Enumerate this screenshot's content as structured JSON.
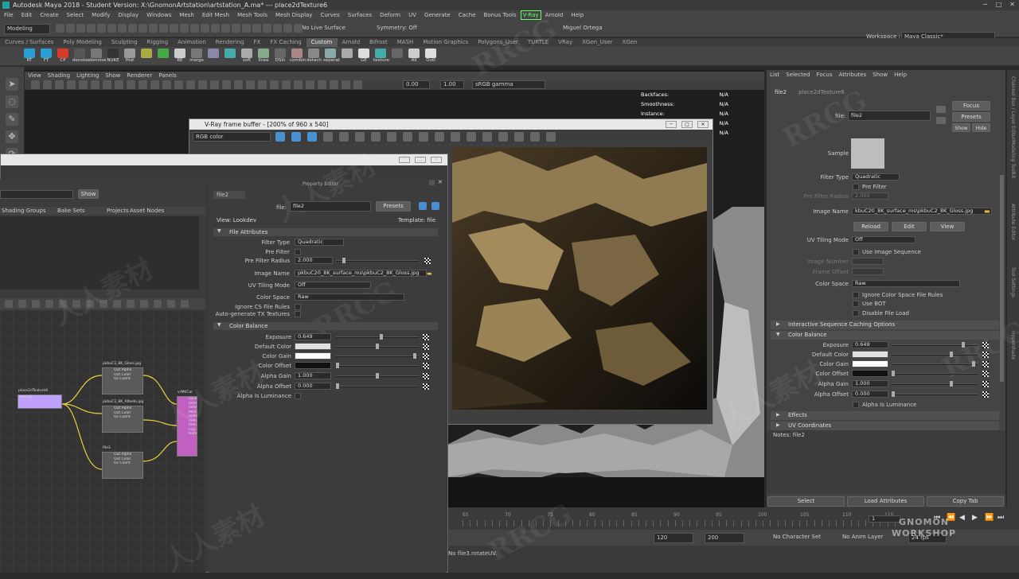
{
  "titlebar": {
    "title": "Autodesk Maya 2018 - Student Version: X:\\GnomonArtstation\\artstation_A.ma*   ---   place2dTexture6"
  },
  "menubar": [
    "File",
    "Edit",
    "Create",
    "Select",
    "Modify",
    "Display",
    "Windows",
    "Mesh",
    "Edit Mesh",
    "Mesh Tools",
    "Mesh Display",
    "Curves",
    "Surfaces",
    "Deform",
    "UV",
    "Generate",
    "Cache",
    "Bonus Tools",
    "V-Ray",
    "Arnold",
    "Help"
  ],
  "workspace": {
    "label": "Workspace :",
    "value": "Maya Classic*"
  },
  "status": {
    "mode": "Modeling",
    "live": "No Live Surface",
    "symmetry": "Symmetry: Off",
    "user": "Miguel Ortega"
  },
  "shelf_tabs": [
    "Curves / Surfaces",
    "Poly Modeling",
    "Sculpting",
    "Rigging",
    "Animation",
    "Rendering",
    "FX",
    "FX Caching",
    "Custom",
    "Arnold",
    "Bifrost",
    "MASH",
    "Motion Graphics",
    "Polygons_User",
    "TURTLE",
    "VRay",
    "XGen_User",
    "XGen"
  ],
  "shelf_active": "Custom",
  "shelf_buttons": [
    "RT",
    "FT",
    "CP",
    "denoise",
    "denoise",
    "NUKE",
    "Hist",
    "",
    "",
    "BE",
    "merge",
    "",
    "",
    "soft",
    "linee",
    "DSln",
    "combin",
    "detach",
    "seperat",
    "",
    "GE",
    "texture",
    "",
    "All",
    "Outl"
  ],
  "viewport": {
    "menu": [
      "View",
      "Shading",
      "Lighting",
      "Show",
      "Renderer",
      "Panels"
    ],
    "exposure": "0.00",
    "gamma": "1.00",
    "colorspace": "sRGB gamma",
    "hud": [
      {
        "k": "Backfaces:",
        "v": "N/A"
      },
      {
        "k": "Smoothness:",
        "v": "N/A"
      },
      {
        "k": "Instance:",
        "v": "N/A"
      },
      {
        "k": "",
        "v": "N/A"
      },
      {
        "k": "",
        "v": "N/A"
      }
    ]
  },
  "vfb": {
    "title": "V-Ray frame buffer - [200% of 960 x 540]",
    "channel": "RGB color"
  },
  "hypershade": {
    "show": "Show",
    "tabs": [
      "Shading Groups",
      "Bake Sets",
      "Projects",
      "Asset Nodes"
    ],
    "nodes": [
      {
        "title": "place2dTexture6",
        "ports": [
          "Out UV"
        ]
      },
      {
        "title": "pkbuC2_8K_Gloss.jpg",
        "ports": [
          "Out Alpha",
          "Out Color",
          "Uv Coord"
        ]
      },
      {
        "title": "pkbuC2_8K_Albedo.jpg",
        "ports": [
          "Out Alpha",
          "Out Color",
          "Uv Coord"
        ]
      },
      {
        "title": "file3",
        "ports": [
          "Out Alpha",
          "Out Color",
          "Uv Coord"
        ]
      },
      {
        "title": "vrMtlCar",
        "ports": [
          "Opacity M",
          "Reflection",
          "Reflection",
          "Metalness",
          "Reflection",
          "Reflection",
          "Refraction",
          "Fog Color",
          "Bump Map"
        ]
      }
    ]
  },
  "property_editor": {
    "title": "Property Editor",
    "tab": "file2",
    "file_label": "file:",
    "file_value": "file2",
    "presets": "Presets",
    "view": "View: Lookdev",
    "template": "Template: file",
    "sections": [
      "File Attributes",
      "Color Balance"
    ],
    "file_attrs": [
      {
        "label": "Filter Type",
        "value": "Quadratic"
      },
      {
        "label": "Pre Filter",
        "value": ""
      },
      {
        "label": "Pre Filter Radius",
        "value": "2.000"
      },
      {
        "label": "UV Tiling Mode",
        "value": "Off"
      },
      {
        "label": "Image Name",
        "value": "pkbuC20_8K_surface_ms\\pkbuC2_8K_Gloss.jpg"
      },
      {
        "label": "Color Space",
        "value": "Raw"
      },
      {
        "label": "Ignore CS File Rules",
        "value": ""
      },
      {
        "label": "Auto-generate TX Textures",
        "value": ""
      }
    ],
    "color_balance": [
      {
        "label": "Exposure",
        "value": "0.649",
        "pos": 0.55
      },
      {
        "label": "Default Color",
        "value": "",
        "pos": 0.5
      },
      {
        "label": "Color Gain",
        "value": "",
        "pos": 0.97
      },
      {
        "label": "Color Offset",
        "value": "",
        "pos": 0.0
      },
      {
        "label": "Alpha Gain",
        "value": "1.000",
        "pos": 0.5
      },
      {
        "label": "Alpha Offset",
        "value": "0.000",
        "pos": 0.0
      }
    ],
    "alpha_lum": "Alpha Is Luminance"
  },
  "attr_editor": {
    "menu": [
      "List",
      "Selected",
      "Focus",
      "Attributes",
      "Show",
      "Help"
    ],
    "tabs": [
      "file2",
      "place2dTexture6"
    ],
    "file_label": "file:",
    "file_value": "file2",
    "focus": "Focus",
    "presets": "Presets",
    "show": "Show",
    "hide": "Hide",
    "sample": "Sample",
    "rows": [
      {
        "label": "Filter Type",
        "value": "Quadratic"
      },
      {
        "label": "Pre Filter Radius",
        "value": "2.000"
      },
      {
        "label": "Image Name",
        "value": "kbuC20_8K_surface_ms\\pkbuC2_8K_Gloss.jpg"
      },
      {
        "label": "UV Tiling Mode",
        "value": "Off"
      },
      {
        "label": "Image Number",
        "value": ""
      },
      {
        "label": "Frame Offset",
        "value": ""
      },
      {
        "label": "Color Space",
        "value": "Raw"
      }
    ],
    "checks": [
      "Pre Filter",
      "Use Image Sequence",
      "Ignore Color Space File Rules",
      "Use BOT",
      "Disable File Load",
      "Alpha Is Luminance"
    ],
    "buttons": [
      "Reload",
      "Edit",
      "View"
    ],
    "sections": [
      "Interactive Sequence Caching Options",
      "Color Balance",
      "Effects",
      "UV Coordinates"
    ],
    "balance": [
      {
        "label": "Exposure",
        "value": "0.649",
        "pos": 0.85
      },
      {
        "label": "Default Color",
        "value": "",
        "pos": 0.7
      },
      {
        "label": "Color Gain",
        "value": "",
        "pos": 0.97
      },
      {
        "label": "Color Offset",
        "value": "",
        "pos": 0.0
      },
      {
        "label": "Alpha Gain",
        "value": "1.000",
        "pos": 0.7
      },
      {
        "label": "Alpha Offset",
        "value": "0.000",
        "pos": 0.0
      }
    ],
    "notes": "Notes:  file2",
    "bottom": [
      "Select",
      "Load Attributes",
      "Copy Tab"
    ]
  },
  "timeline": {
    "ticks": [
      "65",
      "70",
      "75",
      "80",
      "85",
      "90",
      "95",
      "100",
      "105",
      "110",
      "115"
    ],
    "frame": "1",
    "start": "120",
    "end": "200",
    "charset": "No Character Set",
    "anim": "No Anim Layer",
    "fps": "24 fps"
  },
  "cmd": {
    "text": "No file3.rotateUV."
  },
  "side_tabs": [
    "Channel Box / Layer Editor",
    "Modeling Toolkit",
    "Attribute Editor",
    "Tool Settings",
    "Hypershade"
  ],
  "watermarks": [
    "RRCG",
    "人人素材",
    "RRCG",
    "人人素材",
    "RRCG",
    "人人素材",
    "RRCG",
    "人人素材",
    "人人素材",
    "RRCG"
  ],
  "logo": {
    "line1": "GNOMON",
    "line2": "WORKSHOP"
  }
}
